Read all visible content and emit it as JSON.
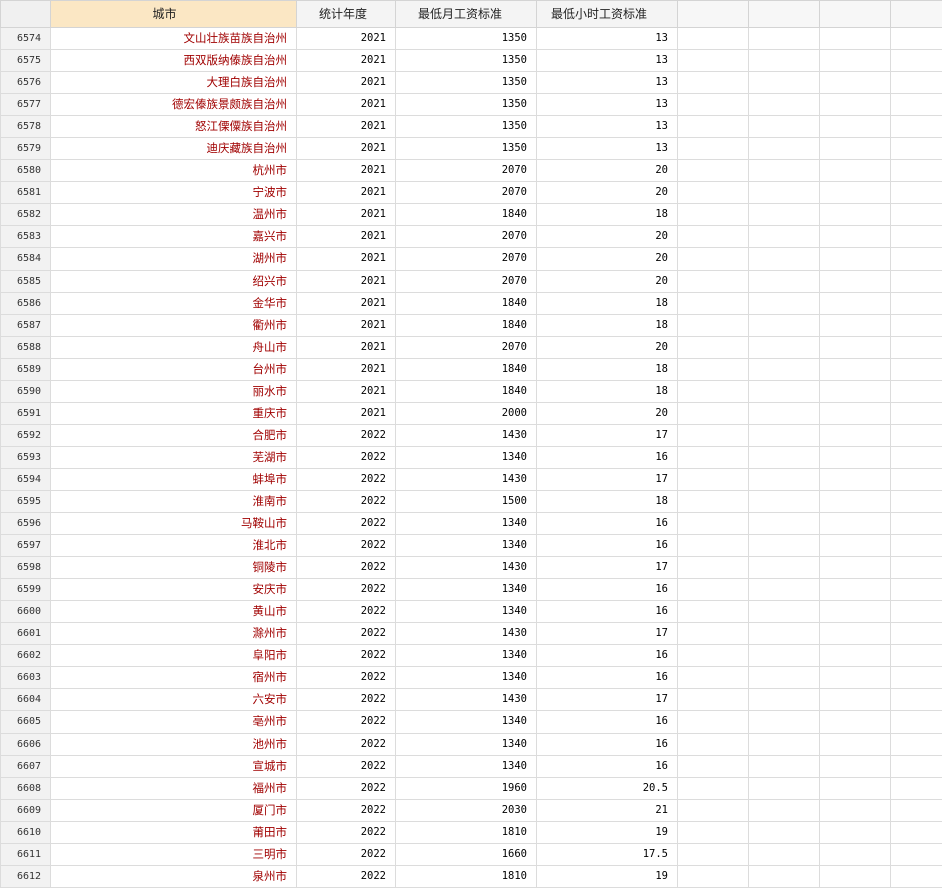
{
  "columns": {
    "row_header": "",
    "city": "城市",
    "year": "统计年度",
    "monthly_min_wage": "最低月工资标准",
    "hourly_min_wage": "最低小时工资标准"
  },
  "rows": [
    {
      "num": "6574",
      "city": "文山壮族苗族自治州",
      "year": "2021",
      "monthly": "1350",
      "hourly": "13"
    },
    {
      "num": "6575",
      "city": "西双版纳傣族自治州",
      "year": "2021",
      "monthly": "1350",
      "hourly": "13"
    },
    {
      "num": "6576",
      "city": "大理白族自治州",
      "year": "2021",
      "monthly": "1350",
      "hourly": "13"
    },
    {
      "num": "6577",
      "city": "德宏傣族景颇族自治州",
      "year": "2021",
      "monthly": "1350",
      "hourly": "13"
    },
    {
      "num": "6578",
      "city": "怒江傈僳族自治州",
      "year": "2021",
      "monthly": "1350",
      "hourly": "13"
    },
    {
      "num": "6579",
      "city": "迪庆藏族自治州",
      "year": "2021",
      "monthly": "1350",
      "hourly": "13"
    },
    {
      "num": "6580",
      "city": "杭州市",
      "year": "2021",
      "monthly": "2070",
      "hourly": "20"
    },
    {
      "num": "6581",
      "city": "宁波市",
      "year": "2021",
      "monthly": "2070",
      "hourly": "20"
    },
    {
      "num": "6582",
      "city": "温州市",
      "year": "2021",
      "monthly": "1840",
      "hourly": "18"
    },
    {
      "num": "6583",
      "city": "嘉兴市",
      "year": "2021",
      "monthly": "2070",
      "hourly": "20"
    },
    {
      "num": "6584",
      "city": "湖州市",
      "year": "2021",
      "monthly": "2070",
      "hourly": "20"
    },
    {
      "num": "6585",
      "city": "绍兴市",
      "year": "2021",
      "monthly": "2070",
      "hourly": "20"
    },
    {
      "num": "6586",
      "city": "金华市",
      "year": "2021",
      "monthly": "1840",
      "hourly": "18"
    },
    {
      "num": "6587",
      "city": "衢州市",
      "year": "2021",
      "monthly": "1840",
      "hourly": "18"
    },
    {
      "num": "6588",
      "city": "舟山市",
      "year": "2021",
      "monthly": "2070",
      "hourly": "20"
    },
    {
      "num": "6589",
      "city": "台州市",
      "year": "2021",
      "monthly": "1840",
      "hourly": "18"
    },
    {
      "num": "6590",
      "city": "丽水市",
      "year": "2021",
      "monthly": "1840",
      "hourly": "18"
    },
    {
      "num": "6591",
      "city": "重庆市",
      "year": "2021",
      "monthly": "2000",
      "hourly": "20"
    },
    {
      "num": "6592",
      "city": "合肥市",
      "year": "2022",
      "monthly": "1430",
      "hourly": "17"
    },
    {
      "num": "6593",
      "city": "芜湖市",
      "year": "2022",
      "monthly": "1340",
      "hourly": "16"
    },
    {
      "num": "6594",
      "city": "蚌埠市",
      "year": "2022",
      "monthly": "1430",
      "hourly": "17"
    },
    {
      "num": "6595",
      "city": "淮南市",
      "year": "2022",
      "monthly": "1500",
      "hourly": "18"
    },
    {
      "num": "6596",
      "city": "马鞍山市",
      "year": "2022",
      "monthly": "1340",
      "hourly": "16"
    },
    {
      "num": "6597",
      "city": "淮北市",
      "year": "2022",
      "monthly": "1340",
      "hourly": "16"
    },
    {
      "num": "6598",
      "city": "铜陵市",
      "year": "2022",
      "monthly": "1430",
      "hourly": "17"
    },
    {
      "num": "6599",
      "city": "安庆市",
      "year": "2022",
      "monthly": "1340",
      "hourly": "16"
    },
    {
      "num": "6600",
      "city": "黄山市",
      "year": "2022",
      "monthly": "1340",
      "hourly": "16"
    },
    {
      "num": "6601",
      "city": "滁州市",
      "year": "2022",
      "monthly": "1430",
      "hourly": "17"
    },
    {
      "num": "6602",
      "city": "阜阳市",
      "year": "2022",
      "monthly": "1340",
      "hourly": "16"
    },
    {
      "num": "6603",
      "city": "宿州市",
      "year": "2022",
      "monthly": "1340",
      "hourly": "16"
    },
    {
      "num": "6604",
      "city": "六安市",
      "year": "2022",
      "monthly": "1430",
      "hourly": "17"
    },
    {
      "num": "6605",
      "city": "亳州市",
      "year": "2022",
      "monthly": "1340",
      "hourly": "16"
    },
    {
      "num": "6606",
      "city": "池州市",
      "year": "2022",
      "monthly": "1340",
      "hourly": "16"
    },
    {
      "num": "6607",
      "city": "宣城市",
      "year": "2022",
      "monthly": "1340",
      "hourly": "16"
    },
    {
      "num": "6608",
      "city": "福州市",
      "year": "2022",
      "monthly": "1960",
      "hourly": "20.5"
    },
    {
      "num": "6609",
      "city": "厦门市",
      "year": "2022",
      "monthly": "2030",
      "hourly": "21"
    },
    {
      "num": "6610",
      "city": "莆田市",
      "year": "2022",
      "monthly": "1810",
      "hourly": "19"
    },
    {
      "num": "6611",
      "city": "三明市",
      "year": "2022",
      "monthly": "1660",
      "hourly": "17.5"
    },
    {
      "num": "6612",
      "city": "泉州市",
      "year": "2022",
      "monthly": "1810",
      "hourly": "19"
    }
  ],
  "colors": {
    "city_text": "#a00000",
    "selected_header": "#fbe7c4",
    "header_bg": "#f4f4f4",
    "gridline": "#dcdcdc"
  }
}
